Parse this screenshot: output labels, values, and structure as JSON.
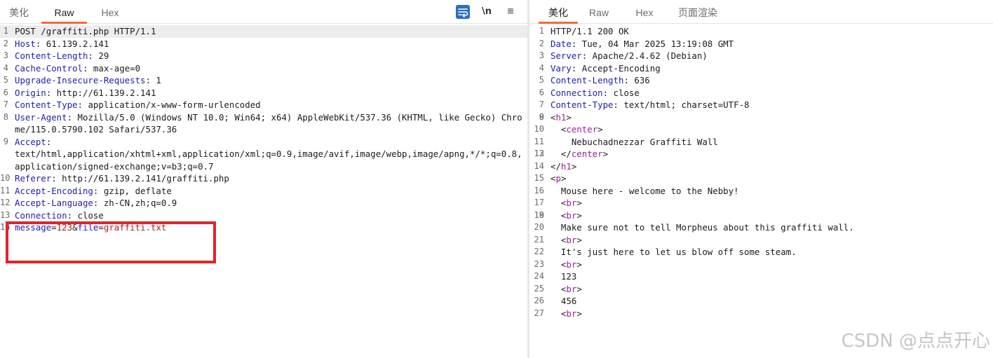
{
  "request_pane": {
    "tabs": [
      "美化",
      "Raw",
      "Hex"
    ],
    "active_tab": "Raw",
    "tools": {
      "newline_label": "\\n",
      "menu_glyph": "≡",
      "wrap_glyph": "⏎"
    },
    "lines": [
      {
        "n": "1",
        "parts": [
          {
            "t": "POST /graffiti.php HTTP/1.1"
          }
        ]
      },
      {
        "n": "2",
        "parts": [
          {
            "t": "Host",
            "c": "kw"
          },
          {
            "t": ": 61.139.2.141"
          }
        ]
      },
      {
        "n": "3",
        "parts": [
          {
            "t": "Content-Length",
            "c": "kw"
          },
          {
            "t": ": 29"
          }
        ]
      },
      {
        "n": "4",
        "parts": [
          {
            "t": "Cache-Control",
            "c": "kw"
          },
          {
            "t": ": max-age=0"
          }
        ]
      },
      {
        "n": "5",
        "parts": [
          {
            "t": "Upgrade-Insecure-Requests",
            "c": "kw"
          },
          {
            "t": ": 1"
          }
        ]
      },
      {
        "n": "6",
        "parts": [
          {
            "t": "Origin",
            "c": "kw"
          },
          {
            "t": ": http://61.139.2.141"
          }
        ]
      },
      {
        "n": "7",
        "parts": [
          {
            "t": "Content-Type",
            "c": "kw"
          },
          {
            "t": ": application/x-www-form-urlencoded"
          }
        ]
      },
      {
        "n": "8",
        "parts": [
          {
            "t": "User-Agent",
            "c": "kw"
          },
          {
            "t": ": Mozilla/5.0 (Windows NT 10.0; Win64; x64) AppleWebKit/537.36 (KHTML, like Gecko) Chrome/115.0.5790.102 Safari/537.36"
          }
        ]
      },
      {
        "n": "9",
        "parts": [
          {
            "t": "Accept",
            "c": "kw"
          },
          {
            "t": ":\ntext/html,application/xhtml+xml,application/xml;q=0.9,image/avif,image/webp,image/apng,*/*;q=0.8,application/signed-exchange;v=b3;q=0.7"
          }
        ]
      },
      {
        "n": "10",
        "parts": [
          {
            "t": "Referer",
            "c": "kw"
          },
          {
            "t": ": http://61.139.2.141/graffiti.php"
          }
        ]
      },
      {
        "n": "11",
        "parts": [
          {
            "t": "Accept-Encoding",
            "c": "kw"
          },
          {
            "t": ": gzip, deflate"
          }
        ]
      },
      {
        "n": "12",
        "parts": [
          {
            "t": "Accept-Language",
            "c": "kw"
          },
          {
            "t": ": zh-CN,zh;q=0.9"
          }
        ]
      },
      {
        "n": "13",
        "parts": [
          {
            "t": "Connection",
            "c": "kw"
          },
          {
            "t": ": close"
          }
        ]
      },
      {
        "n": "14",
        "parts": [
          {
            "t": ""
          }
        ]
      },
      {
        "n": "15",
        "parts": [
          {
            "t": "message",
            "c": "kw"
          },
          {
            "t": "="
          },
          {
            "t": "123",
            "c": "pval"
          },
          {
            "t": "&"
          },
          {
            "t": "file",
            "c": "kw"
          },
          {
            "t": "="
          },
          {
            "t": "graffiti.txt",
            "c": "pval"
          }
        ]
      }
    ]
  },
  "response_pane": {
    "tabs": [
      "美化",
      "Raw",
      "Hex",
      "页面渲染"
    ],
    "active_tab": "美化",
    "lines": [
      {
        "n": "1",
        "parts": [
          {
            "t": "HTTP/1.1 200 OK"
          }
        ]
      },
      {
        "n": "2",
        "parts": [
          {
            "t": "Date",
            "c": "kw"
          },
          {
            "t": ": Tue, 04 Mar 2025 13:19:08 GMT"
          }
        ]
      },
      {
        "n": "3",
        "parts": [
          {
            "t": "Server",
            "c": "kw"
          },
          {
            "t": ": Apache/2.4.62 (Debian)"
          }
        ]
      },
      {
        "n": "4",
        "parts": [
          {
            "t": "Vary",
            "c": "kw"
          },
          {
            "t": ": Accept-Encoding"
          }
        ]
      },
      {
        "n": "5",
        "parts": [
          {
            "t": "Content-Length",
            "c": "kw"
          },
          {
            "t": ": 636"
          }
        ]
      },
      {
        "n": "6",
        "parts": [
          {
            "t": "Connection",
            "c": "kw"
          },
          {
            "t": ": close"
          }
        ]
      },
      {
        "n": "7",
        "parts": [
          {
            "t": "Content-Type",
            "c": "kw"
          },
          {
            "t": ": text/html; charset=UTF-8"
          }
        ]
      },
      {
        "n": "8",
        "parts": [
          {
            "t": ""
          }
        ]
      },
      {
        "n": "9",
        "parts": [
          {
            "t": "<"
          },
          {
            "t": "h1",
            "c": "tag"
          },
          {
            "t": ">"
          }
        ]
      },
      {
        "n": "10",
        "parts": [
          {
            "t": "  <"
          },
          {
            "t": "center",
            "c": "tag"
          },
          {
            "t": ">"
          }
        ]
      },
      {
        "n": "11",
        "parts": [
          {
            "t": "    Nebuchadnezzar Graffiti Wall"
          }
        ]
      },
      {
        "n": "12",
        "parts": [
          {
            "t": ""
          }
        ]
      },
      {
        "n": "13",
        "parts": [
          {
            "t": "  </"
          },
          {
            "t": "center",
            "c": "tag"
          },
          {
            "t": ">"
          }
        ]
      },
      {
        "n": "14",
        "parts": [
          {
            "t": "</"
          },
          {
            "t": "h1",
            "c": "tag"
          },
          {
            "t": ">"
          }
        ]
      },
      {
        "n": "15",
        "parts": [
          {
            "t": "<"
          },
          {
            "t": "p",
            "c": "tag"
          },
          {
            "t": ">"
          }
        ]
      },
      {
        "n": "16",
        "parts": [
          {
            "t": "  Mouse here - welcome to the Nebby!"
          }
        ]
      },
      {
        "n": "17",
        "parts": [
          {
            "t": "  <"
          },
          {
            "t": "br",
            "c": "tag"
          },
          {
            "t": ">"
          }
        ]
      },
      {
        "n": "18",
        "parts": [
          {
            "t": ""
          }
        ]
      },
      {
        "n": "19",
        "parts": [
          {
            "t": "  <"
          },
          {
            "t": "br",
            "c": "tag"
          },
          {
            "t": ">"
          }
        ]
      },
      {
        "n": "20",
        "parts": [
          {
            "t": "  Make sure not to tell Morpheus about this graffiti wall."
          }
        ]
      },
      {
        "n": "21",
        "parts": [
          {
            "t": "  <"
          },
          {
            "t": "br",
            "c": "tag"
          },
          {
            "t": ">"
          }
        ]
      },
      {
        "n": "22",
        "parts": [
          {
            "t": "  It's just here to let us blow off some steam."
          }
        ]
      },
      {
        "n": "23",
        "parts": [
          {
            "t": "  <"
          },
          {
            "t": "br",
            "c": "tag"
          },
          {
            "t": ">"
          }
        ]
      },
      {
        "n": "24",
        "parts": [
          {
            "t": "  123"
          }
        ]
      },
      {
        "n": "25",
        "parts": [
          {
            "t": "  <"
          },
          {
            "t": "br",
            "c": "tag"
          },
          {
            "t": ">"
          }
        ]
      },
      {
        "n": "26",
        "parts": [
          {
            "t": "  456"
          }
        ]
      },
      {
        "n": "27",
        "parts": [
          {
            "t": "  <"
          },
          {
            "t": "br",
            "c": "tag"
          },
          {
            "t": ">"
          }
        ]
      }
    ]
  },
  "watermark": "CSDN @点点开心",
  "colors": {
    "accent": "#ff6633",
    "header_name": "#1d1db3",
    "html_tag": "#9b1f9b",
    "param_value": "#a3211f",
    "annotation_box": "#e0242a",
    "wrap_button": "#2f6fbf"
  }
}
